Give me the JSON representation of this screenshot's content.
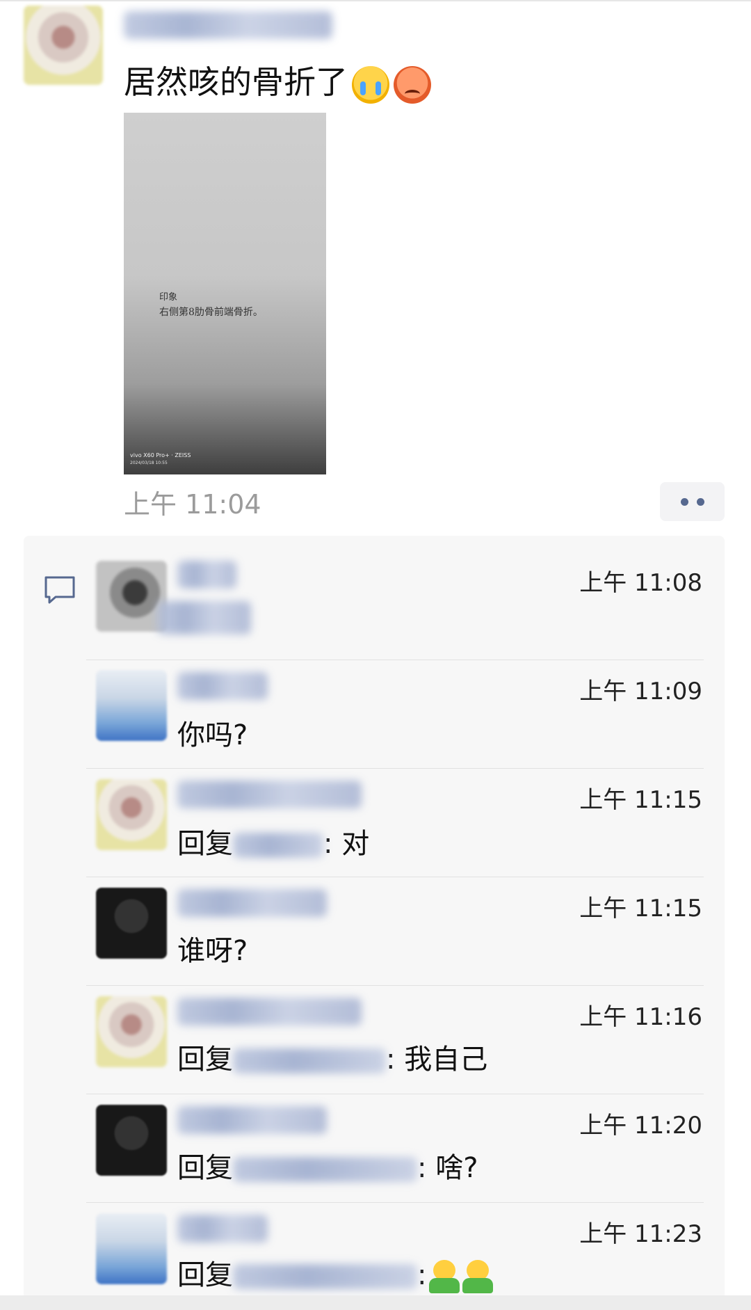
{
  "post": {
    "text": "居然咳的骨折了",
    "emojis": [
      "crying-face-emoji",
      "angry-face-emoji"
    ],
    "photo_lines": [
      "印象",
      "右侧第8肋骨前端骨折。"
    ],
    "photo_watermark": "vivo X60 Pro+ · ZEISS",
    "photo_watermark_date": "2024/03/18 10:55",
    "time": "上午 11:04"
  },
  "comments": [
    {
      "time": "上午 11:08",
      "text": ""
    },
    {
      "time": "上午 11:09",
      "text": "你吗?"
    },
    {
      "time": "上午 11:15",
      "prefix": "回复",
      "suffix": ": 对"
    },
    {
      "time": "上午 11:15",
      "text": "谁呀?"
    },
    {
      "time": "上午 11:16",
      "prefix": "回复",
      "suffix": ": 我自己"
    },
    {
      "time": "上午 11:20",
      "prefix": "回复",
      "suffix": ": 啥?"
    },
    {
      "time": "上午 11:23",
      "prefix": "回复",
      "suffix": ":"
    }
  ],
  "colors": {
    "link_blue": "#56688f",
    "time_gray": "#9b9b9b",
    "panel_bg": "#f7f7f7"
  },
  "icons": {
    "comment": "comment-bubble-icon",
    "more": "more-dots-icon"
  }
}
